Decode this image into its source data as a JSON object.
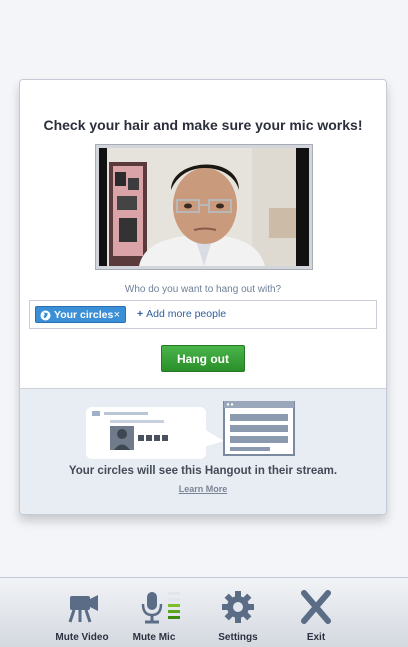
{
  "dialog": {
    "headline": "Check your hair and make sure your mic works!",
    "question": "Who do you want to hang out with?",
    "share": {
      "chip_label": "Your circles",
      "chip_remove": "×",
      "add_plus": "+",
      "add_label": "Add more people"
    },
    "hangout_button": "Hang out",
    "stream_notice": "Your circles will see this Hangout in their stream.",
    "learn_more": "Learn More"
  },
  "toolbar": {
    "items": [
      {
        "label": "Mute Video",
        "icon": "video-camera-icon"
      },
      {
        "label": "Mute Mic",
        "icon": "microphone-icon"
      },
      {
        "label": "Settings",
        "icon": "gear-icon"
      },
      {
        "label": "Exit",
        "icon": "exit-x-icon"
      }
    ]
  },
  "colors": {
    "accent_blue": "#3b8fd6",
    "hangout_green": "#2a8f2a",
    "link_blue": "#2f5f9e"
  }
}
